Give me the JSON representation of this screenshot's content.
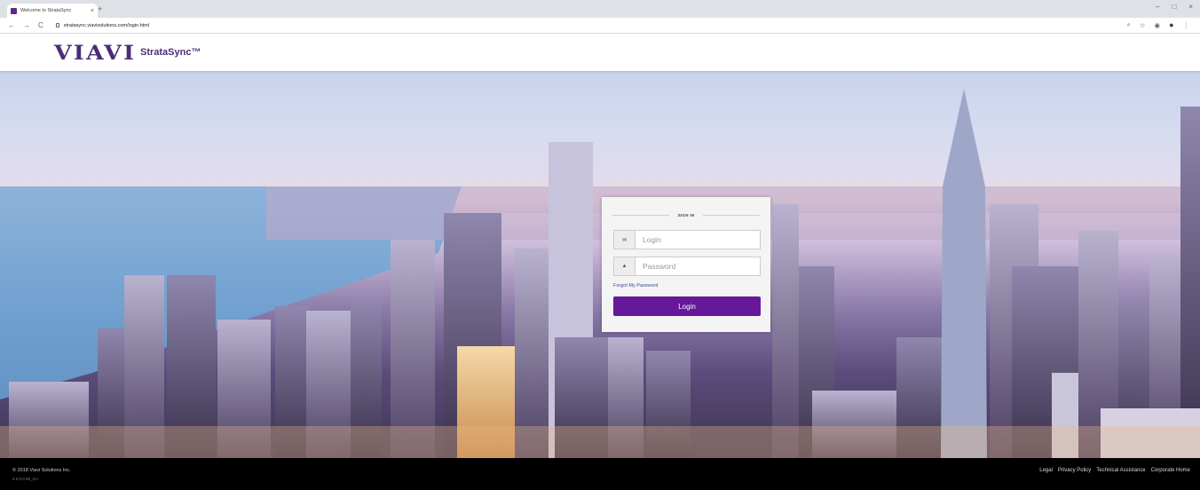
{
  "browser": {
    "tab_title": "Welcome to StrataSync",
    "tab_close": "×",
    "new_tab": "+",
    "url": "stratasync.viavisolutions.com/login.html",
    "window_controls": [
      "–",
      "□",
      "×"
    ],
    "nav": {
      "back": "←",
      "forward": "→",
      "reload": "C"
    },
    "toolbar_icons": [
      "⌕",
      "☆",
      "◉",
      "⋮"
    ]
  },
  "header": {
    "logo_text": "VIAVI",
    "brand": "StrataSync™"
  },
  "login_card": {
    "heading": "SIGN IN",
    "login_placeholder": "Login",
    "password_placeholder": "Password",
    "email_icon": "✉",
    "lock_icon": "🔒",
    "forgot_link": "Forgot My Password",
    "submit_label": "Login",
    "accent_color": "#65189a"
  },
  "footer": {
    "copyright": "© 2018 Viavi Solutions Inc.",
    "version": "8.6.0.0.96_GA",
    "links": [
      "Legal",
      "Privacy Policy",
      "Technical Assistance",
      "Corporate Home"
    ]
  }
}
